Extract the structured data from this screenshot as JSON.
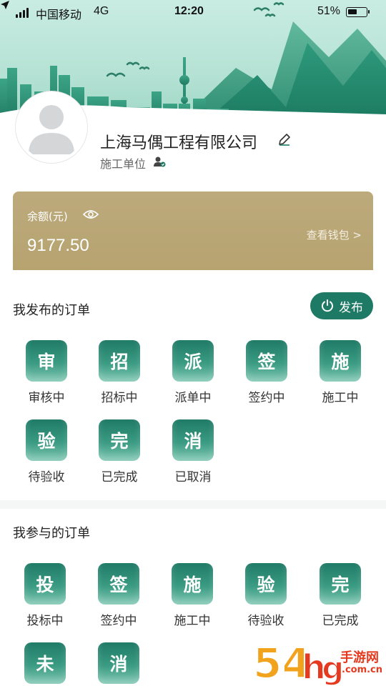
{
  "status_bar": {
    "carrier": "中国移动",
    "network": "4G",
    "time": "12:20",
    "battery": "51%",
    "battery_level": 0.51
  },
  "profile": {
    "company_name": "上海马偶工程有限公司",
    "role": "施工单位"
  },
  "wallet": {
    "balance_label": "余额(元)",
    "balance": "9177.50",
    "view_wallet_label": "查看钱包 >"
  },
  "my_published_orders": {
    "title": "我发布的订单",
    "publish_button": "发布",
    "items": [
      {
        "glyph": "审",
        "label": "审核中"
      },
      {
        "glyph": "招",
        "label": "招标中"
      },
      {
        "glyph": "派",
        "label": "派单中"
      },
      {
        "glyph": "签",
        "label": "签约中"
      },
      {
        "glyph": "施",
        "label": "施工中"
      },
      {
        "glyph": "验",
        "label": "待验收"
      },
      {
        "glyph": "完",
        "label": "已完成"
      },
      {
        "glyph": "消",
        "label": "已取消"
      }
    ]
  },
  "my_participated_orders": {
    "title": "我参与的订单",
    "items": [
      {
        "glyph": "投",
        "label": "投标中"
      },
      {
        "glyph": "签",
        "label": "签约中"
      },
      {
        "glyph": "施",
        "label": "施工中"
      },
      {
        "glyph": "验",
        "label": "待验收"
      },
      {
        "glyph": "完",
        "label": "已完成"
      },
      {
        "glyph": "未",
        "label": ""
      },
      {
        "glyph": "消",
        "label": ""
      }
    ]
  },
  "watermark": {
    "text": "手游网",
    "domain": ".com.cn"
  },
  "colors": {
    "brand_green": "#1f7a65",
    "wallet_gold": "#b6a370"
  }
}
